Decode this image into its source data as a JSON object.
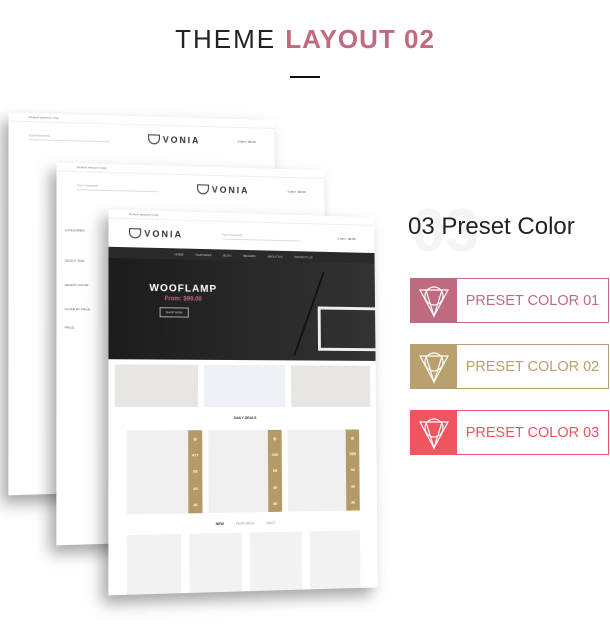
{
  "header": {
    "title_main": "THEME",
    "title_accent": "LAYOUT 02"
  },
  "accent_color": "#c06a80",
  "mockup": {
    "topbar_text": "Default welcome msg!",
    "brand": "VONIA",
    "search_placeholder": "Type Keywords",
    "cart": "0 Item - $0.00",
    "nav": [
      "HOME",
      "FEATURES",
      "BLOG",
      "BRANDS",
      "ABOUT US",
      "CONTACT US"
    ],
    "sidebar": [
      "CATEGORIES",
      "SELECT SIZE",
      "SELECT COLOR",
      "FILTER BY PRICE",
      "PRICE"
    ],
    "banner": {
      "headline": "WOOFLAMP",
      "price": "From: $99.00",
      "button": "SHOP NOW"
    },
    "deals_title": "DAILY DEALS",
    "deals": [
      {
        "countdown": [
          "477",
          "08",
          "49",
          "36"
        ]
      },
      {
        "countdown": [
          "435",
          "08",
          "49",
          "36"
        ]
      },
      {
        "countdown": [
          "385",
          "08",
          "49",
          "36"
        ]
      }
    ],
    "tabs": [
      "NEW",
      "FEATURED",
      "SALE"
    ]
  },
  "presets": {
    "heading": "03 Preset Color",
    "ghost_number": "03",
    "items": [
      {
        "label": "PRESET COLOR 01",
        "color": "#c06a80",
        "icon": "vonia-logo-icon"
      },
      {
        "label": "PRESET COLOR 02",
        "color": "#b9a06e",
        "icon": "vonia-logo-icon"
      },
      {
        "label": "PRESET COLOR 03",
        "color": "#ef5461",
        "icon": "vonia-logo-icon"
      }
    ]
  }
}
